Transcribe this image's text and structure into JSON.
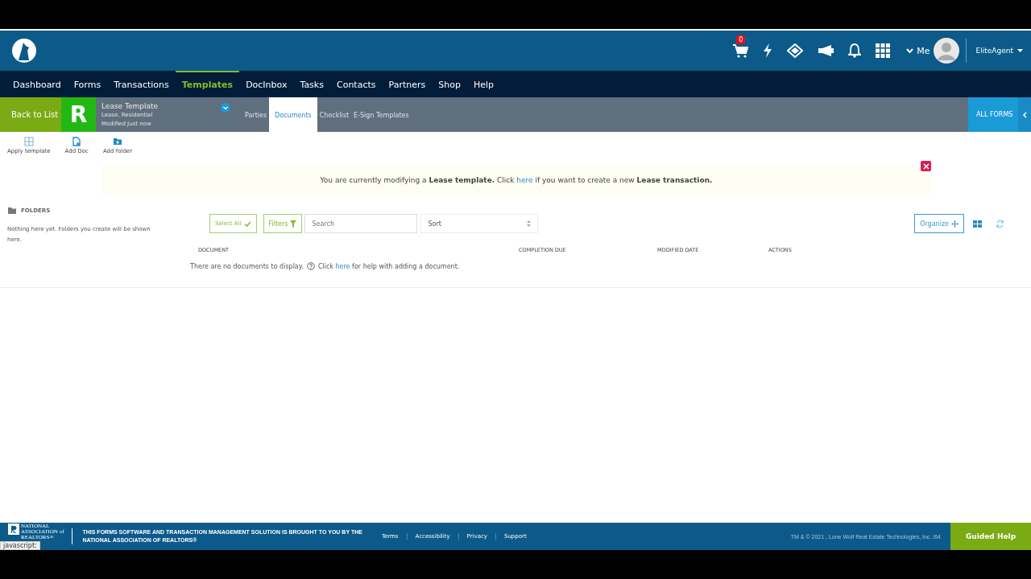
{
  "header": {
    "cart_count": "0",
    "me_label": "Me",
    "user": "EliteAgent"
  },
  "nav": [
    {
      "label": "Dashboard",
      "selected": false
    },
    {
      "label": "Forms",
      "selected": false
    },
    {
      "label": "Transactions",
      "selected": false
    },
    {
      "label": "Templates",
      "selected": true
    },
    {
      "label": "DocInbox",
      "selected": false
    },
    {
      "label": "Tasks",
      "selected": false
    },
    {
      "label": "Contacts",
      "selected": false
    },
    {
      "label": "Partners",
      "selected": false
    },
    {
      "label": "Shop",
      "selected": false
    },
    {
      "label": "Help",
      "selected": false
    }
  ],
  "subbar": {
    "back": "Back to List",
    "badge": "R",
    "title": "Lease Template",
    "lines": [
      "Lease, Residential",
      "Modified Just now"
    ],
    "tabs": [
      {
        "label": "Parties",
        "selected": false
      },
      {
        "label": "Documents",
        "selected": true
      },
      {
        "label": "Checklist",
        "selected": false
      },
      {
        "label": "E-Sign Templates",
        "selected": false
      }
    ],
    "all_forms": "ALL FORMS"
  },
  "toolbar": [
    {
      "label": "Apply template",
      "kind": "grid"
    },
    {
      "label": "Add Doc",
      "kind": "doc"
    },
    {
      "label": "Add folder",
      "kind": "folder"
    }
  ],
  "banner": {
    "before": "You are currently modifying a **Lease template.** Click",
    "link": "here",
    "after": "if you want to create a new **Lease transaction.**"
  },
  "folders": {
    "title": "FOLDERS",
    "empty": "Nothing here yet. Folders you create will be shown here."
  },
  "controls": {
    "select_all": "Select All",
    "filters": "Filters",
    "search_placeholder": "Search",
    "sort": "Sort",
    "organize": "Organize"
  },
  "table": {
    "columns": [
      "DOCUMENT",
      "COMPLETION DUE",
      "MODIFIED DATE",
      "ACTIONS"
    ],
    "empty": {
      "before": "There are no documents to display.",
      "click": "Click",
      "link": "here",
      "after": "for help with adding a document."
    }
  },
  "footer": {
    "logo_lines": [
      "NATIONAL",
      "ASSOCIATION of",
      "REALTORS®"
    ],
    "notice": [
      "THIS FORMS SOFTWARE AND TRANSACTION MANAGEMENT SOLUTION IS BROUGHT TO YOU BY THE",
      "NATIONAL ASSOCIATION OF REALTORS®"
    ],
    "links": [
      "Terms",
      "Accessibility",
      "Privacy",
      "Support"
    ],
    "copyright": "TM & © 2021 , Lone Wolf Real Estate Technologies, Inc. /64",
    "guided_help": "Guided Help"
  },
  "status_text": "javascript:"
}
